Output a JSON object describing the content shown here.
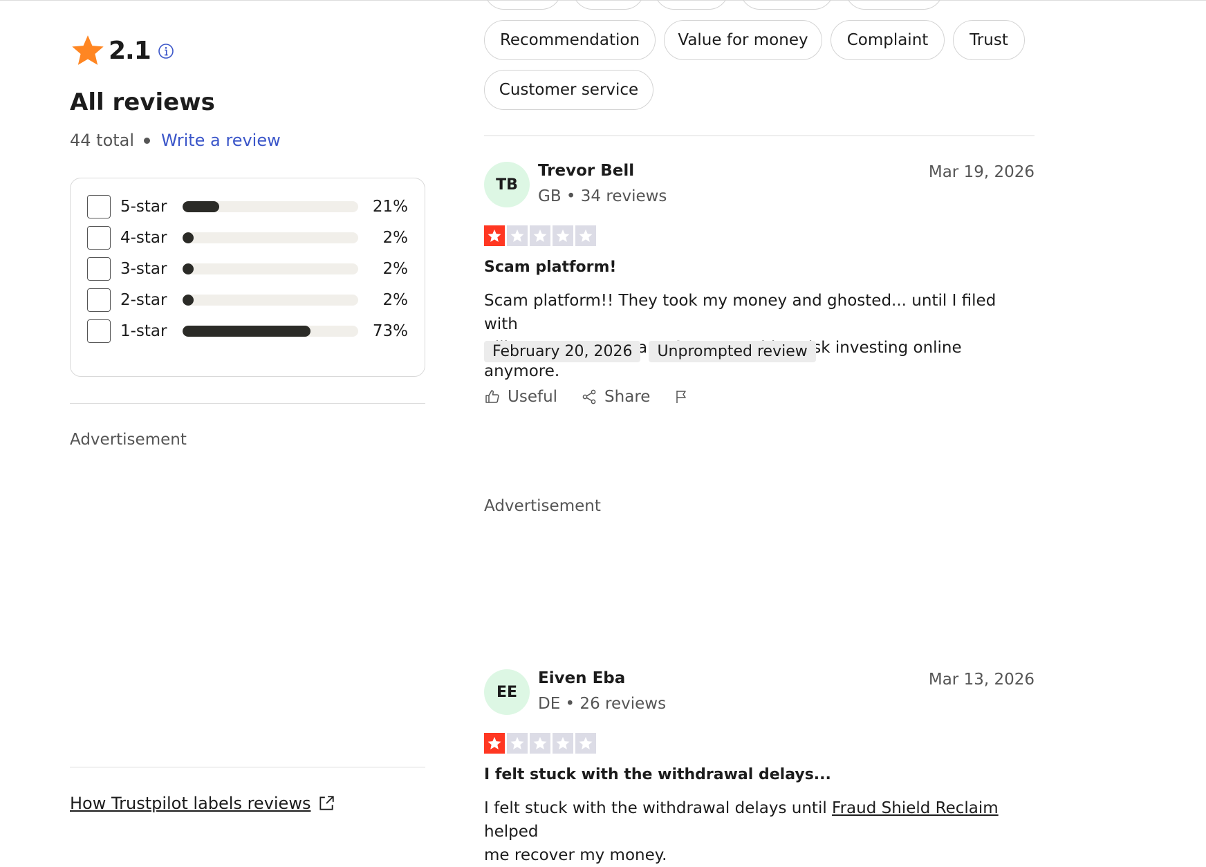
{
  "summary": {
    "rating": "2.1",
    "heading": "All reviews",
    "total": "44 total",
    "write_review": "Write a review"
  },
  "distribution": [
    {
      "label": "5-star",
      "percent_text": "21%",
      "percent": 21
    },
    {
      "label": "4-star",
      "percent_text": "2%",
      "percent": 2
    },
    {
      "label": "3-star",
      "percent_text": "2%",
      "percent": 2
    },
    {
      "label": "2-star",
      "percent_text": "2%",
      "percent": 2
    },
    {
      "label": "1-star",
      "percent_text": "73%",
      "percent": 73
    }
  ],
  "advertisement_label": "Advertisement",
  "how_labels_link": "How Trustpilot labels reviews",
  "topic_chips": [
    "Recommendation",
    "Value for money",
    "Complaint",
    "Trust",
    "Customer service"
  ],
  "reviews": [
    {
      "initials": "TB",
      "name": "Trevor Bell",
      "meta": "GB • 34 reviews",
      "date": "Mar 19, 2026",
      "stars": 1,
      "title": "Scam platform!",
      "body_line1": "Scam platform!! They took my money and ghosted... until I filed with",
      "body_line2": "Alliance-Asset-Bureau •Com. I wouldn’t risk investing online anymore.",
      "experience_date": "February 20, 2026",
      "label": "Unprompted review",
      "useful": "Useful",
      "share": "Share"
    },
    {
      "initials": "EE",
      "name": "Eiven Eba",
      "meta": "DE • 26 reviews",
      "date": "Mar 13, 2026",
      "stars": 1,
      "title": "I felt stuck with the withdrawal delays...",
      "body_pre": "I felt stuck with the withdrawal delays until ",
      "body_link": "Fraud Shield Reclaim",
      "body_post": " helped",
      "body_line2": "me recover my money."
    }
  ],
  "colors": {
    "star_orange": "#ff8622",
    "star_red": "#ff3722",
    "star_empty": "#dcdce6",
    "link_blue": "#3b56c9",
    "bar_fill": "#2b2b27",
    "avatar_bg": "#ddf7e4"
  },
  "icons": {
    "rating_star": "star-icon",
    "info": "info-icon",
    "external": "external-link-icon",
    "useful": "thumbs-up-icon",
    "share": "share-icon",
    "report": "flag-icon"
  }
}
